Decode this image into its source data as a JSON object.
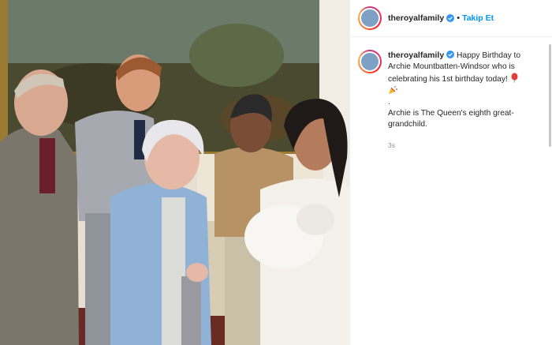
{
  "post": {
    "username": "theroyalfamily",
    "follow_label": "Takip Et",
    "separator": "•",
    "caption_line1": "Happy Birthday to Archie Mountbatten-Windsor who is celebrating his 1st birthday today!",
    "caption_dot": ".",
    "caption_line2": "Archie is The Queen's eighth great-grandchild.",
    "timestamp": "3s",
    "emoji_1": "balloon-icon",
    "emoji_2": "party-popper-icon"
  },
  "colors": {
    "link_blue": "#0095f6",
    "verified_blue": "#3897f0",
    "meta_gray": "#8e8e8e"
  }
}
